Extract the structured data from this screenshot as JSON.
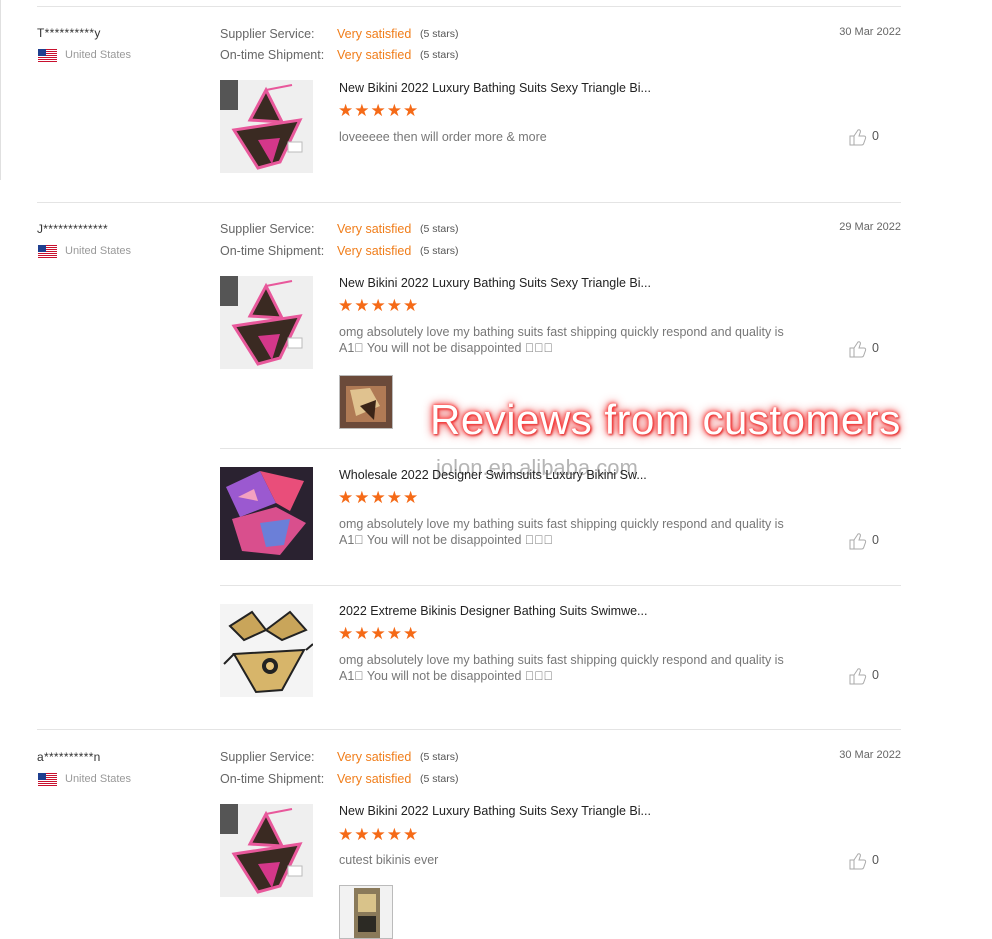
{
  "overlay_text": "Reviews from customers",
  "watermark": "jolon.en.alibaba.com",
  "labels": {
    "supplier_service": "Supplier Service:",
    "on_time_shipment": "On-time Shipment:",
    "very_satisfied": "Very satisfied",
    "five_stars": "(5 stars)"
  },
  "stars": "★★★★★",
  "colors": {
    "accent_orange": "#f07d1a",
    "star_orange": "#f56a17",
    "overlay_glow": "#ff3a3a"
  },
  "reviews": [
    {
      "user": "T**********y",
      "country": "United States",
      "date": "30 Mar 2022",
      "supplier_rating": "Very satisfied",
      "supplier_stars": "(5 stars)",
      "shipment_rating": "Very satisfied",
      "shipment_stars": "(5 stars)",
      "products": [
        {
          "title": "New Bikini 2022 Luxury Bathing Suits Sexy Triangle Bi...",
          "rating": 5,
          "comment": "loveeeee then will order more & more",
          "likes": "0",
          "image_icon": "pink-triangle-bikini-thumbnail"
        }
      ]
    },
    {
      "user": "J*************",
      "country": "United States",
      "date": "29 Mar 2022",
      "supplier_rating": "Very satisfied",
      "supplier_stars": "(5 stars)",
      "shipment_rating": "Very satisfied",
      "shipment_stars": "(5 stars)",
      "products": [
        {
          "title": "New Bikini 2022 Luxury Bathing Suits Sexy Triangle Bi...",
          "rating": 5,
          "comment_line1": "omg absolutely love my bathing suits fast shipping quickly respond and quality is",
          "comment_line2": "A1\u0000 You will not be disappointed \u0000\u0000\u0000",
          "likes": "0",
          "image_icon": "pink-triangle-bikini-thumbnail",
          "has_photo": true
        },
        {
          "title": "Wholesale 2022 Designer Swimsuits Luxury Bikini Sw...",
          "rating": 5,
          "comment_line1": "omg absolutely love my bathing suits fast shipping quickly respond and quality is",
          "comment_line2": "A1\u0000 You will not be disappointed \u0000\u0000\u0000",
          "likes": "0",
          "image_icon": "tie-dye-bikini-thumbnail"
        },
        {
          "title": "2022 Extreme Bikinis Designer Bathing Suits Swimwe...",
          "rating": 5,
          "comment_line1": "omg absolutely love my bathing suits fast shipping quickly respond and quality is",
          "comment_line2": "A1\u0000 You will not be disappointed \u0000\u0000\u0000",
          "likes": "0",
          "image_icon": "baroque-print-bikini-thumbnail"
        }
      ]
    },
    {
      "user": "a**********n",
      "country": "United States",
      "date": "30 Mar 2022",
      "supplier_rating": "Very satisfied",
      "supplier_stars": "(5 stars)",
      "shipment_rating": "Very satisfied",
      "shipment_stars": "(5 stars)",
      "products": [
        {
          "title": "New Bikini 2022 Luxury Bathing Suits Sexy Triangle Bi...",
          "rating": 5,
          "comment": "cutest bikinis ever",
          "likes": "0",
          "image_icon": "pink-triangle-bikini-thumbnail",
          "has_photo": true
        }
      ]
    }
  ]
}
